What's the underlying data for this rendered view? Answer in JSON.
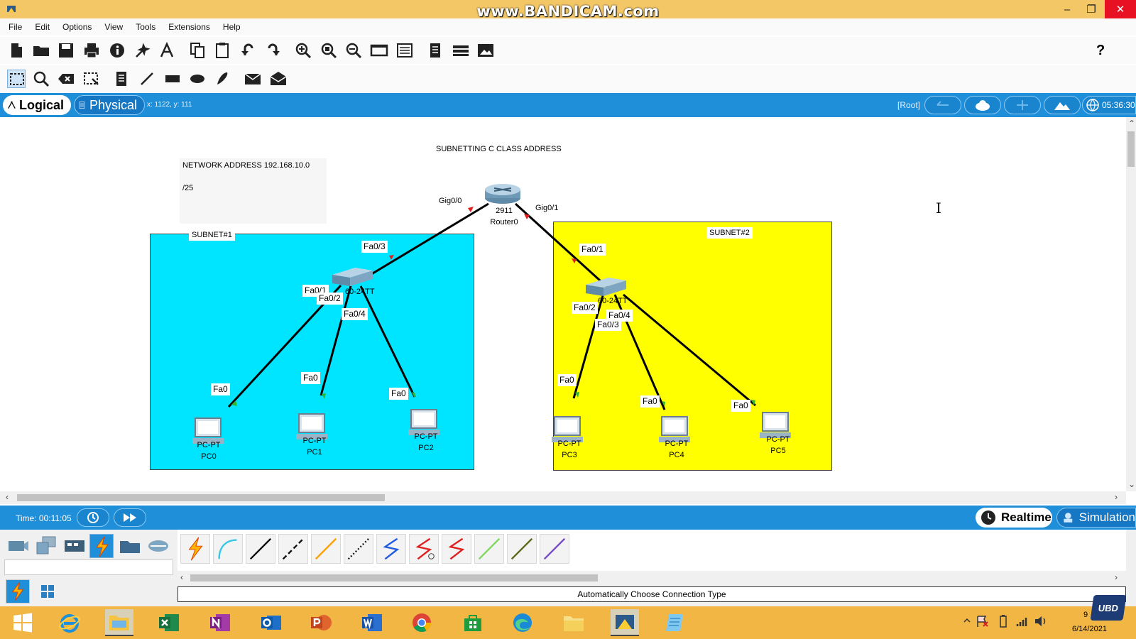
{
  "titlebar": {
    "watermark": "www.BANDICAM.com",
    "minimize": "–",
    "maximize": "❐",
    "close": "✕"
  },
  "menu": [
    "File",
    "Edit",
    "Options",
    "View",
    "Tools",
    "Extensions",
    "Help"
  ],
  "toolbar1_icons": [
    "new-file-icon",
    "open-folder-icon",
    "save-icon",
    "print-icon",
    "info-icon",
    "activity-wizard-icon",
    "text-icon",
    "copy-icon",
    "paste-icon",
    "undo-icon",
    "redo-icon",
    "zoom-in-icon",
    "zoom-reset-icon",
    "zoom-out-icon",
    "drawing-palette-icon",
    "custom-device-dialog-icon",
    "viewport-icon",
    "ipc-icon",
    "screenshot-icon"
  ],
  "toolbar1_help": "?",
  "toolbar2_icons": [
    "select-icon",
    "inspect-icon",
    "delete-icon",
    "resize-icon",
    "place-note-icon",
    "draw-line-icon",
    "draw-rectangle-icon",
    "draw-ellipse-icon",
    "freeform-icon",
    "add-simple-pdu-icon",
    "add-complex-pdu-icon"
  ],
  "workspace": {
    "logical": "Logical",
    "physical": "Physical",
    "coords": "x: 1122, y: 111",
    "root": "[Root]",
    "clock": "05:36:30"
  },
  "canvas": {
    "title_note": "SUBNETTING C CLASS ADDRESS",
    "network_note": "NETWORK ADDRESS 192.168.10.0",
    "mask_note": "/25",
    "subnet1_label": "SUBNET#1",
    "subnet2_label": "SUBNET#2",
    "subnet1_color": "#00e5ff",
    "subnet2_color": "#ffff00",
    "link_color": "#000000",
    "router": {
      "model": "2911",
      "name": "Router0"
    },
    "switch_label_partial": "60-24TT",
    "ports": {
      "r_gig00": "Gig0/0",
      "r_gig01": "Gig0/1",
      "s0_fa03": "Fa0/3",
      "s0_fa01": "Fa0/1",
      "s0_fa02": "Fa0/2",
      "s0_fa04": "Fa0/4",
      "s1_fa01": "Fa0/1",
      "s1_fa02": "Fa0/2",
      "s1_fa03": "Fa0/3",
      "s1_fa04": "Fa0/4",
      "pc0_fa0": "Fa0",
      "pc1_fa0": "Fa0",
      "pc2_fa0": "Fa0",
      "pc3_fa0": "Fa0",
      "pc4_fa0": "Fa0",
      "pc5_fa0": "Fa0"
    },
    "pcs": [
      {
        "type": "PC-PT",
        "name": "PC0"
      },
      {
        "type": "PC-PT",
        "name": "PC1"
      },
      {
        "type": "PC-PT",
        "name": "PC2"
      },
      {
        "type": "PC-PT",
        "name": "PC3"
      },
      {
        "type": "PC-PT",
        "name": "PC4"
      },
      {
        "type": "PC-PT",
        "name": "PC5"
      }
    ]
  },
  "timebar": {
    "time": "Time: 00:11:05",
    "realtime": "Realtime",
    "simulation": "Simulation"
  },
  "devices": {
    "categories": [
      "network-devices-icon",
      "end-devices-icon",
      "components-icon",
      "connections-icon",
      "miscellaneous-icon",
      "multiuser-icon"
    ],
    "cables": [
      "automatic-cable-icon",
      "console-cable-icon",
      "straight-through-cable-icon",
      "crossover-cable-icon",
      "fiber-cable-icon",
      "phone-cable-icon",
      "coaxial-cable-icon",
      "serial-dce-cable-icon",
      "serial-dte-cable-icon",
      "octal-cable-icon",
      "iot-cable-icon",
      "usb-cable-icon",
      "coaxial-2-cable-icon"
    ],
    "status": "Automatically Choose Connection Type"
  },
  "taskbar": {
    "apps": [
      "windows-start-icon",
      "internet-explorer-icon",
      "file-explorer-icon",
      "excel-icon",
      "onenote-icon",
      "outlook-icon",
      "powerpoint-icon",
      "word-icon",
      "chrome-icon",
      "store-icon",
      "edge-icon",
      "folder-icon",
      "packet-tracer-icon",
      "notepad-icon"
    ],
    "date": "6/14/2021",
    "time_partial": "9",
    "badge": "UBD"
  }
}
